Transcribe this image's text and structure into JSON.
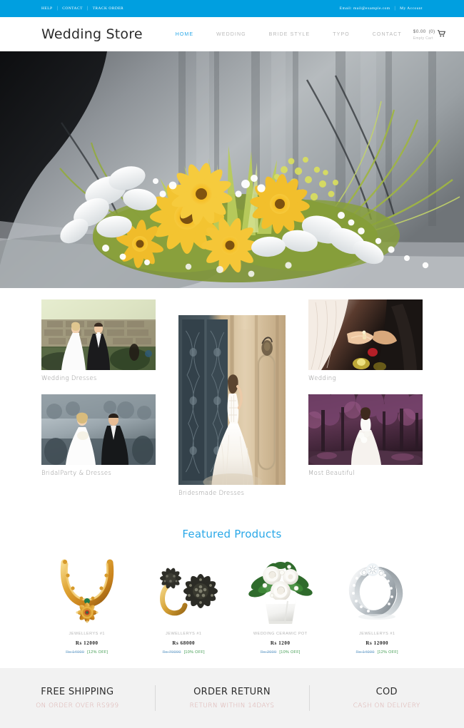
{
  "topbar": {
    "background_color": "#009fe0",
    "left_links": [
      {
        "label": "HELP"
      },
      {
        "label": "CONTACT"
      },
      {
        "label": "TRACK ORDER"
      }
    ],
    "email_label": "Email: mail@example.com",
    "account_label": "My Account",
    "separator": "|"
  },
  "header": {
    "logo": "Wedding Store",
    "nav": [
      {
        "label": "HOME",
        "active": true
      },
      {
        "label": "WEDDING",
        "active": false
      },
      {
        "label": "BRIDE STYLE",
        "active": false
      },
      {
        "label": "TYPO",
        "active": false
      },
      {
        "label": "CONTACT",
        "active": false
      }
    ],
    "cart": {
      "total": "$0.00",
      "count": "(0)",
      "status": "Empty Cart",
      "icon": "shopping-cart-icon"
    },
    "accent_color": "#2aa8e8"
  },
  "hero": {
    "alt": "Yellow gerbera and white gladiolus wedding car floral arrangement on a dark vehicle hood"
  },
  "categories": {
    "left": [
      {
        "label": "Wedding Dresses",
        "alt": "Bride and groom smiling beside a stone wall garden"
      },
      {
        "label": "BridalParty & Dresses",
        "alt": "Bride and groom embracing at outdoor reception"
      }
    ],
    "center": [
      {
        "label": "Bridesmade Dresses",
        "alt": "Bride in white ball gown standing in ornate doorway"
      }
    ],
    "right": [
      {
        "label": "Wedding",
        "alt": "Groom placing ring on bride's finger close up"
      },
      {
        "label": "Most Beautiful",
        "alt": "Bride with bouquet in purple autumn park"
      }
    ]
  },
  "featured": {
    "title": "Featured Products",
    "title_color": "#2aa8e8",
    "products": [
      {
        "name": "JEWELLERYS #1",
        "price": "Rs 12000",
        "old_price": "Rs 14000",
        "discount": "[12% OFF]",
        "image": "gold-necklace"
      },
      {
        "name": "JEWELLERYS #1",
        "price": "Rs 68000",
        "old_price": "Rs 70000",
        "discount": "[10% OFF]",
        "image": "black-ring-set"
      },
      {
        "name": "WEDDING CERAMIC POT",
        "price": "Rs 1200",
        "old_price": "Rs 2000",
        "discount": "[10% OFF]",
        "image": "white-rose-pot"
      },
      {
        "name": "JEWELLERYS #1",
        "price": "Rs 12000",
        "old_price": "Rs 14000",
        "discount": "[12% OFF]",
        "image": "diamond-ring"
      }
    ]
  },
  "footer": {
    "background_color": "#f2f2f2",
    "subtitle_color": "#d9aaa8",
    "items": [
      {
        "title": "FREE SHIPPING",
        "subtitle": "ON ORDER OVER RS999"
      },
      {
        "title": "ORDER RETURN",
        "subtitle": "RETURN WITHIN 14DAYS"
      },
      {
        "title": "COD",
        "subtitle": "CASH ON DELIVERY"
      }
    ]
  }
}
